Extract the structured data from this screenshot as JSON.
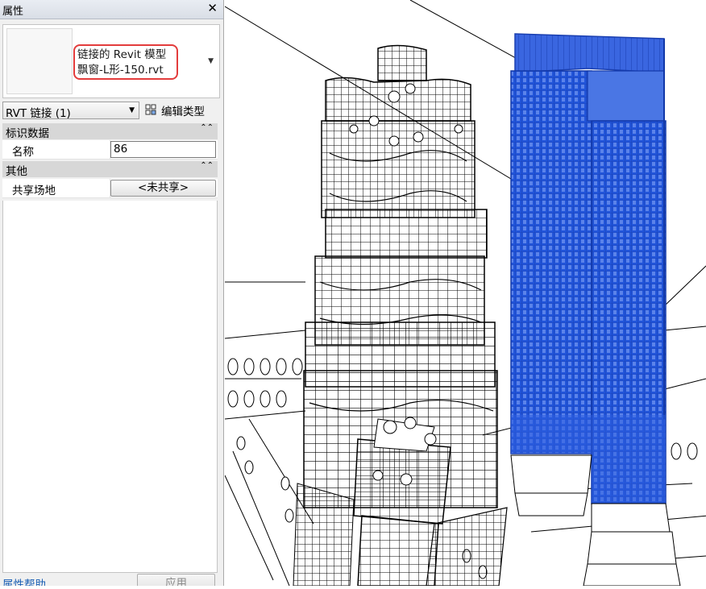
{
  "properties_panel": {
    "title": "属性",
    "close_label": "✕",
    "type_selector": {
      "line1": "链接的 Revit 模型",
      "line2": "飘窗-L形-150.rvt"
    },
    "instance_filter": "RVT 链接 (1)",
    "edit_type_label": "编辑类型",
    "sections": [
      {
        "label": "标识数据",
        "rows": [
          {
            "key": "名称",
            "value": "86"
          }
        ]
      },
      {
        "label": "其他",
        "rows": [
          {
            "key": "共享场地",
            "value": "<未共享>"
          }
        ]
      }
    ],
    "help_link": "属性帮助",
    "apply_button": "应用"
  },
  "viewport": {
    "selected_color": "#1f4fd8",
    "line_color": "#000000"
  }
}
